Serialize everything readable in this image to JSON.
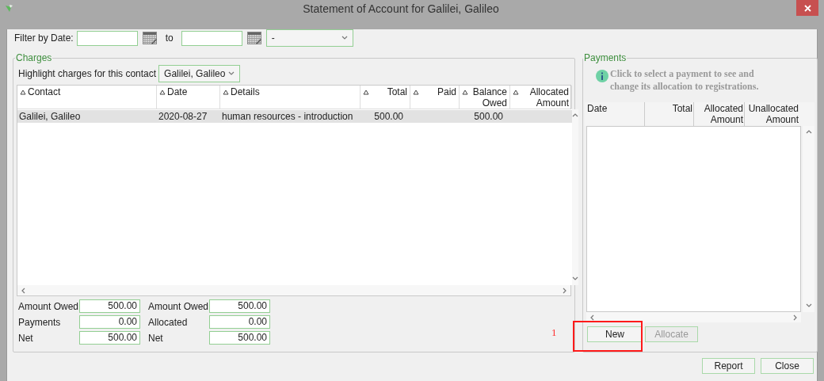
{
  "window": {
    "title": "Statement of Account for Galilei, Galileo"
  },
  "filter": {
    "label": "Filter by Date:",
    "to_label": "to",
    "period": {
      "value": "-"
    }
  },
  "charges": {
    "legend": "Charges",
    "highlight_label": "Highlight charges for this contact",
    "highlight_value": "Galilei, Galileo",
    "columns": [
      {
        "label": "Contact",
        "kind": "text"
      },
      {
        "label": "Date",
        "kind": "text"
      },
      {
        "label": "Details",
        "kind": "text"
      },
      {
        "label": "Total",
        "kind": "number"
      },
      {
        "label": "Paid",
        "kind": "number"
      },
      {
        "label": "Balance Owed",
        "kind": "number"
      },
      {
        "label": "Allocated Amount",
        "kind": "number"
      }
    ],
    "rows": [
      {
        "cells": [
          "Galilei, Galileo",
          "2020-08-27",
          "human resources - introduction",
          "500.00",
          null,
          "500.00",
          null
        ],
        "selected": true
      }
    ],
    "totals": [
      {
        "label": "Amount Owed",
        "value": "500.00"
      },
      {
        "label": "Amount Owed",
        "value": "500.00"
      },
      {
        "label": "Payments",
        "value": "0.00"
      },
      {
        "label": "Allocated",
        "value": "0.00"
      },
      {
        "label": "Net",
        "value": "500.00"
      },
      {
        "label": "Net",
        "value": "500.00"
      }
    ]
  },
  "payments": {
    "legend": "Payments",
    "info": "Click to select a payment to see and change its allocation to registrations.",
    "columns": [
      {
        "label": "Date",
        "kind": "text"
      },
      {
        "label": "Total",
        "kind": "number"
      },
      {
        "label": "Allocated Amount",
        "kind": "number"
      },
      {
        "label": "Unallocated Amount",
        "kind": "number"
      }
    ],
    "buttons": [
      {
        "label": "New",
        "disabled": false
      },
      {
        "label": "Allocate",
        "disabled": true
      }
    ]
  },
  "annotation": {
    "label": "1"
  },
  "buttons": [
    {
      "label": "Report"
    },
    {
      "label": "Close"
    }
  ]
}
